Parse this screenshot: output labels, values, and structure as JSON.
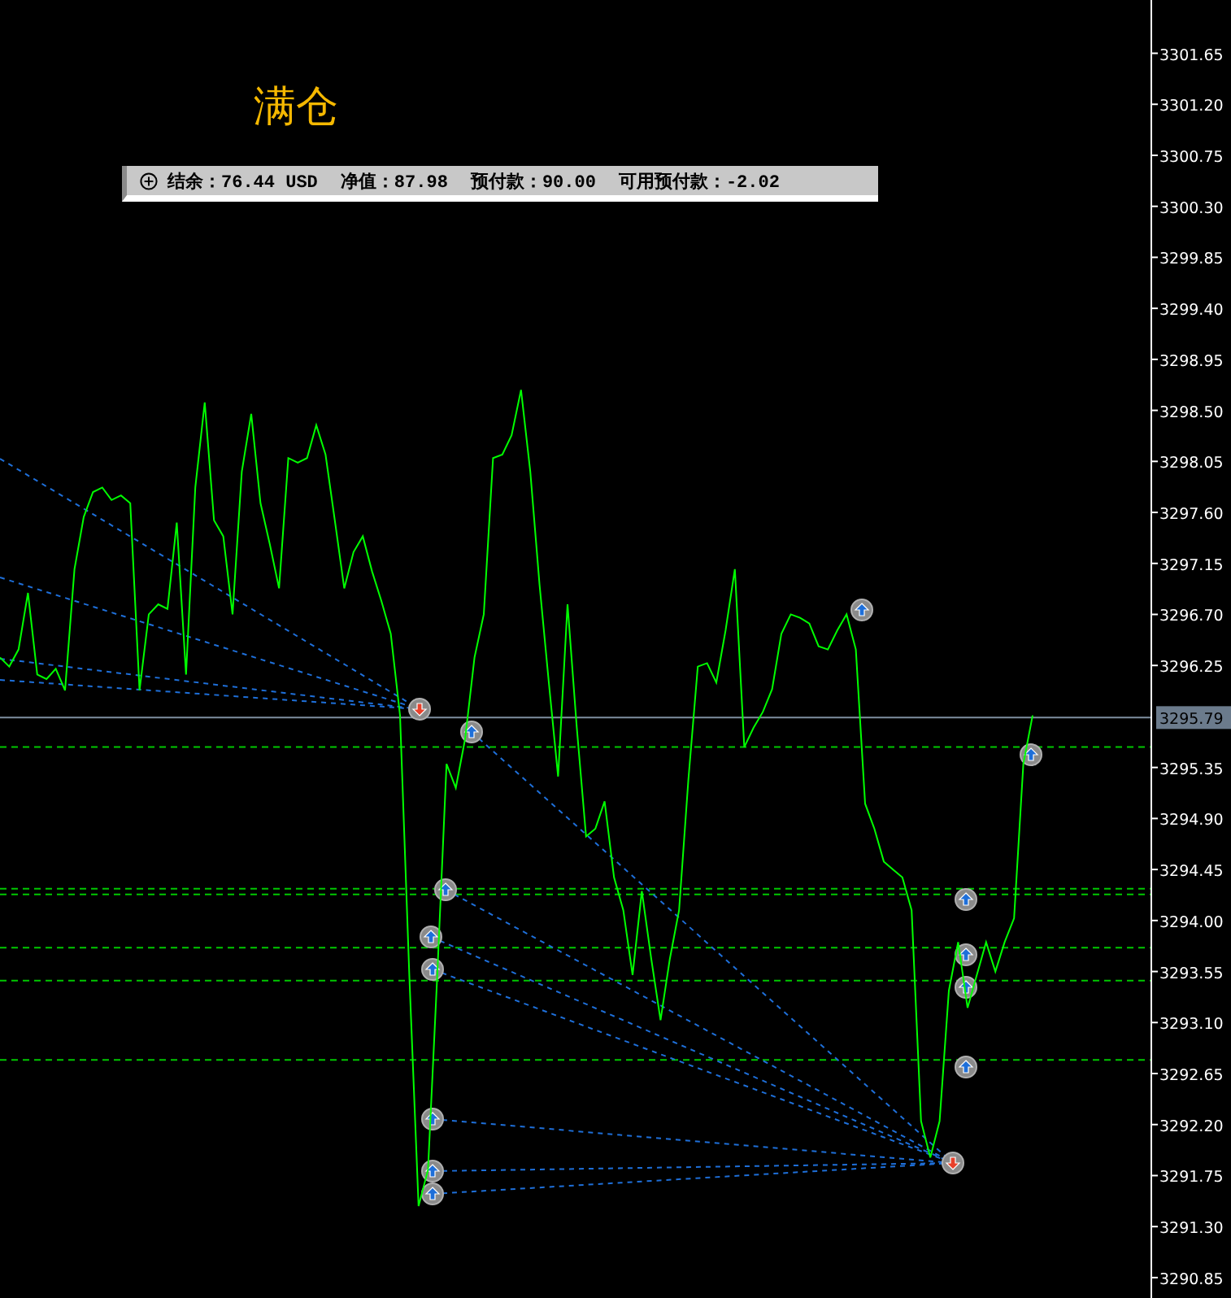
{
  "title": "满仓",
  "account_bar": {
    "items": [
      "结余：76.44 USD",
      "净值：87.98",
      "预付款：90.00",
      "可用预付款：-2.02"
    ]
  },
  "chart_data": {
    "type": "line",
    "ylim": [
      3290.67,
      3302.12
    ],
    "yticks": [
      {
        "value": 3301.65,
        "label": "3301.65"
      },
      {
        "value": 3301.2,
        "label": "3301.20"
      },
      {
        "value": 3300.75,
        "label": "3300.75"
      },
      {
        "value": 3300.3,
        "label": "3300.30"
      },
      {
        "value": 3299.85,
        "label": "3299.85"
      },
      {
        "value": 3299.4,
        "label": "3299.40"
      },
      {
        "value": 3298.95,
        "label": "3298.95"
      },
      {
        "value": 3298.5,
        "label": "3298.50"
      },
      {
        "value": 3298.05,
        "label": "3298.05"
      },
      {
        "value": 3297.6,
        "label": "3297.60"
      },
      {
        "value": 3297.15,
        "label": "3297.15"
      },
      {
        "value": 3296.7,
        "label": "3296.70"
      },
      {
        "value": 3296.25,
        "label": "3296.25"
      },
      {
        "value": 3295.35,
        "label": "3295.35"
      },
      {
        "value": 3294.9,
        "label": "3294.90"
      },
      {
        "value": 3294.45,
        "label": "3294.45"
      },
      {
        "value": 3294.0,
        "label": "3294.00"
      },
      {
        "value": 3293.55,
        "label": "3293.55"
      },
      {
        "value": 3293.1,
        "label": "3293.10"
      },
      {
        "value": 3292.65,
        "label": "3292.65"
      },
      {
        "value": 3292.2,
        "label": "3292.20"
      },
      {
        "value": 3291.75,
        "label": "3291.75"
      },
      {
        "value": 3291.3,
        "label": "3291.30"
      },
      {
        "value": 3290.85,
        "label": "3290.85"
      }
    ],
    "series": [
      {
        "color": "#00ff00",
        "values": [
          3296.32,
          3296.24,
          3296.39,
          3296.89,
          3296.17,
          3296.13,
          3296.22,
          3296.03,
          3297.1,
          3297.56,
          3297.78,
          3297.82,
          3297.71,
          3297.75,
          3297.68,
          3296.03,
          3296.7,
          3296.79,
          3296.75,
          3297.51,
          3296.17,
          3297.82,
          3298.57,
          3297.53,
          3297.39,
          3296.7,
          3297.96,
          3298.47,
          3297.68,
          3297.32,
          3296.93,
          3298.08,
          3298.04,
          3298.08,
          3298.37,
          3298.11,
          3297.53,
          3296.93,
          3297.25,
          3297.39,
          3297.08,
          3296.82,
          3296.53,
          3295.81,
          3293.52,
          3291.48,
          3291.8,
          3293.52,
          3295.38,
          3295.17,
          3295.6,
          3296.32,
          3296.7,
          3298.08,
          3298.11,
          3298.28,
          3298.68,
          3297.96,
          3296.96,
          3296.1,
          3295.27,
          3296.79,
          3295.7,
          3294.74,
          3294.81,
          3295.05,
          3294.38,
          3294.09,
          3293.52,
          3294.26,
          3293.66,
          3293.12,
          3293.66,
          3294.09,
          3295.24,
          3296.24,
          3296.27,
          3296.1,
          3296.56,
          3297.1,
          3295.53,
          3295.7,
          3295.84,
          3296.04,
          3296.53,
          3296.7,
          3296.67,
          3296.62,
          3296.42,
          3296.39,
          3296.56,
          3296.7,
          3296.39,
          3295.03,
          3294.81,
          3294.52,
          3294.45,
          3294.38,
          3294.09,
          3292.23,
          3291.91,
          3292.23,
          3293.38,
          3293.81,
          3293.23,
          3293.52,
          3293.81,
          3293.55,
          3293.81,
          3294.02,
          3295.38,
          3295.81
        ]
      }
    ],
    "ref_lines": [
      {
        "axis": "y",
        "value": 3295.79,
        "label": "3295.79",
        "color": "#7f8fa0"
      },
      {
        "axis": "y",
        "value": 3295.53,
        "color": "#00c800"
      },
      {
        "axis": "y",
        "value": 3294.28,
        "color": "#00c800"
      },
      {
        "axis": "y",
        "value": 3294.23,
        "color": "#00c800"
      },
      {
        "axis": "y",
        "value": 3293.76,
        "color": "#00c800"
      },
      {
        "axis": "y",
        "value": 3293.47,
        "color": "#00c800"
      },
      {
        "axis": "y",
        "value": 3292.77,
        "color": "#00c800"
      }
    ]
  }
}
